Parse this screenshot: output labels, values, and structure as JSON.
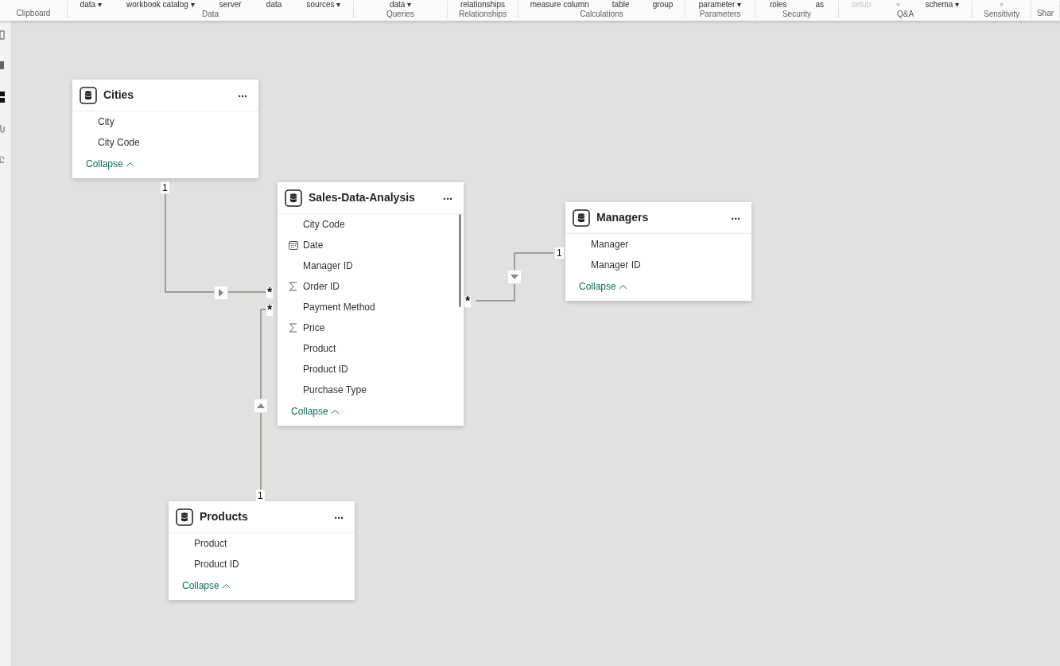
{
  "ribbon": {
    "groups": [
      {
        "label": "Clipboard"
      },
      {
        "label": "Data",
        "items": [
          {
            "text": "data ▾",
            "disabled": false
          },
          {
            "text": "workbook catalog ▾",
            "disabled": false
          },
          {
            "text": "server",
            "disabled": false
          },
          {
            "text": "data",
            "disabled": false
          },
          {
            "text": "sources ▾",
            "disabled": false
          }
        ]
      },
      {
        "label": "Queries",
        "items": [
          {
            "text": "data ▾",
            "disabled": false
          }
        ]
      },
      {
        "label": "Relationships",
        "items": [
          {
            "text": "relationships",
            "disabled": false
          }
        ]
      },
      {
        "label": "Calculations",
        "items": [
          {
            "text": "measure column",
            "disabled": false
          },
          {
            "text": "table",
            "disabled": false
          },
          {
            "text": "group",
            "disabled": false
          }
        ]
      },
      {
        "label": "Parameters",
        "items": [
          {
            "text": "parameter ▾",
            "disabled": false
          }
        ]
      },
      {
        "label": "Security",
        "items": [
          {
            "text": "roles",
            "disabled": false
          },
          {
            "text": "as",
            "disabled": false
          }
        ]
      },
      {
        "label": "Q&A",
        "items": [
          {
            "text": "setup",
            "disabled": true
          },
          {
            "text": "▾",
            "disabled": true
          },
          {
            "text": "schema ▾",
            "disabled": false
          }
        ]
      },
      {
        "label": "Sensitivity",
        "items": [
          {
            "text": "▾",
            "disabled": true
          }
        ]
      },
      {
        "label": "Shar"
      }
    ]
  },
  "tables": [
    {
      "name": "Cities",
      "more": "...",
      "fields": [
        {
          "name": "City",
          "kind": "text"
        },
        {
          "name": "City Code",
          "kind": "text"
        }
      ],
      "collapse": "Collapse"
    },
    {
      "name": "Sales-Data-Analysis",
      "more": "...",
      "fields": [
        {
          "name": "City Code",
          "kind": "text"
        },
        {
          "name": "Date",
          "kind": "date"
        },
        {
          "name": "Manager ID",
          "kind": "text"
        },
        {
          "name": "Order ID",
          "kind": "sum"
        },
        {
          "name": "Payment Method",
          "kind": "text"
        },
        {
          "name": "Price",
          "kind": "sum"
        },
        {
          "name": "Product",
          "kind": "text"
        },
        {
          "name": "Product ID",
          "kind": "text"
        },
        {
          "name": "Purchase Type",
          "kind": "text"
        }
      ],
      "collapse": "Collapse"
    },
    {
      "name": "Managers",
      "more": "...",
      "fields": [
        {
          "name": "Manager",
          "kind": "text"
        },
        {
          "name": "Manager ID",
          "kind": "text"
        }
      ],
      "collapse": "Collapse"
    },
    {
      "name": "Products",
      "more": "...",
      "fields": [
        {
          "name": "Product",
          "kind": "text"
        },
        {
          "name": "Product ID",
          "kind": "text"
        }
      ],
      "collapse": "Collapse"
    }
  ],
  "relationships": [
    {
      "one": "1",
      "many": "*",
      "kind": "right"
    },
    {
      "one": "1",
      "many": "*",
      "kind": "up"
    },
    {
      "one": "1",
      "many": "*",
      "kind": "down"
    }
  ]
}
